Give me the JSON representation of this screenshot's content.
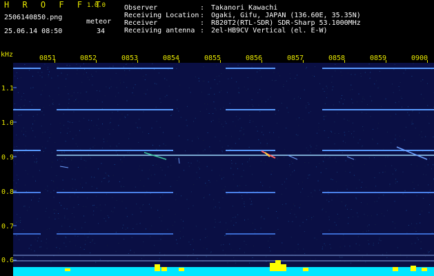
{
  "header": {
    "logo": "H R O F F T",
    "version": "1.0.0",
    "filename": "2506140850.png",
    "datetime": "25.06.14 08:50",
    "meteor_label": "meteor",
    "meteor_count": "34",
    "info": [
      {
        "label": "Observer",
        "value": "Takanori Kawachi"
      },
      {
        "label": "Receiving Location",
        "value": "Ogaki, Gifu, JAPAN (136.60E, 35.35N)"
      },
      {
        "label": "Receiver",
        "value": "R820T2(RTL-SDR) SDR-Sharp 53.1000MHz"
      },
      {
        "label": "Receiving antenna",
        "value": "2el-HB9CV Vertical (el. E-W)"
      }
    ],
    "separator": ":"
  },
  "axis": {
    "unit": "kHz",
    "y_ticks": [
      "1.1",
      "1.0",
      "0.9",
      "0.8",
      "0.7",
      "0.6"
    ],
    "x_ticks": [
      "0851",
      "0852",
      "0853",
      "0854",
      "0855",
      "0856",
      "0857",
      "0858",
      "0859",
      "0900"
    ]
  },
  "colors": {
    "axis_text": "#e8e800",
    "background": "#0a0f44",
    "carrier_line": "#5a9cff",
    "meteor": "#ff6060",
    "power_bar": "#00ffff",
    "power_peak": "#ffff00"
  }
}
